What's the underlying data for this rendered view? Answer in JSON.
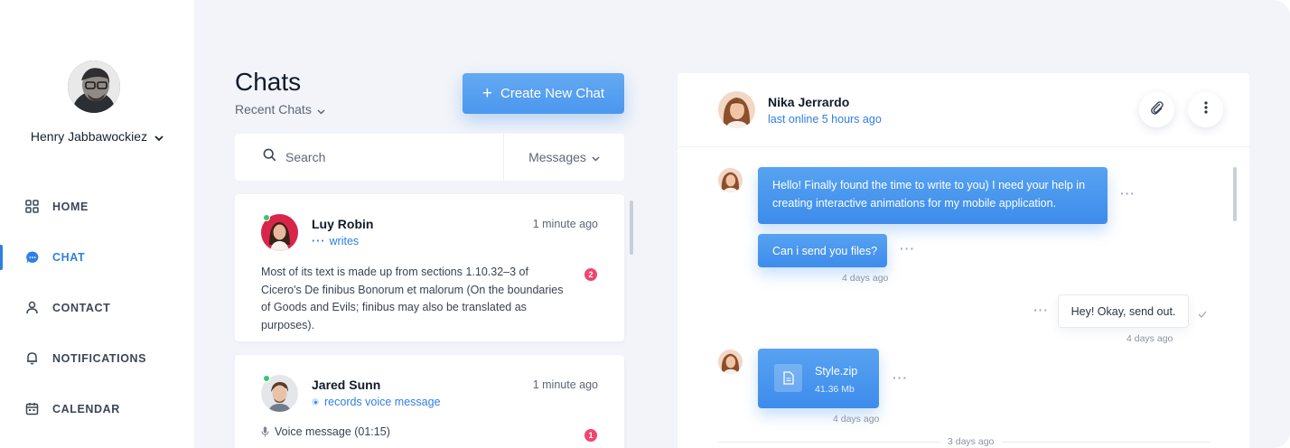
{
  "user": {
    "name": "Henry Jabbawockiez"
  },
  "nav": [
    {
      "label": "HOME",
      "icon": "grid-icon",
      "active": false
    },
    {
      "label": "CHAT",
      "icon": "chat-bubble-icon",
      "active": true
    },
    {
      "label": "CONTACT",
      "icon": "person-icon",
      "active": false
    },
    {
      "label": "NOTIFICATIONS",
      "icon": "bell-icon",
      "active": false
    },
    {
      "label": "CALENDAR",
      "icon": "calendar-icon",
      "active": false
    }
  ],
  "chats": {
    "title": "Chats",
    "filter_label": "Recent Chats",
    "create_label": "Create New Chat",
    "search_placeholder": "Search",
    "type_filter": "Messages"
  },
  "chat_list": [
    {
      "name": "Luy Robin",
      "time": "1 minute ago",
      "status": "writes",
      "preview": "Most of its text is made up from sections 1.10.32–3 of Cicero's De finibus Bonorum et malorum (On the boundaries of Goods and Evils; finibus may also be translated as purposes).",
      "unread": "2"
    },
    {
      "name": "Jared Sunn",
      "time": "1 minute ago",
      "status": "records voice message",
      "preview": "Voice message (01:15)",
      "unread": "1"
    }
  ],
  "conversation": {
    "name": "Nika Jerrardo",
    "last_seen": "last online 5 hours ago",
    "messages": [
      {
        "text": "Hello! Finally found the time to write to you) I need your help in creating interactive animations for my mobile application."
      },
      {
        "text": "Can i send you files?",
        "time": "4 days ago"
      },
      {
        "text": "Hey! Okay, send out.",
        "time": "4 days ago"
      },
      {
        "file_name": "Style.zip",
        "file_size": "41.36 Mb",
        "time": "4 days ago"
      }
    ],
    "divider_label": "3 days ago"
  },
  "colors": {
    "accent": "#2f7fe3",
    "badge": "#f0456d",
    "online": "#3cc46a",
    "background": "#f2f4f9"
  }
}
